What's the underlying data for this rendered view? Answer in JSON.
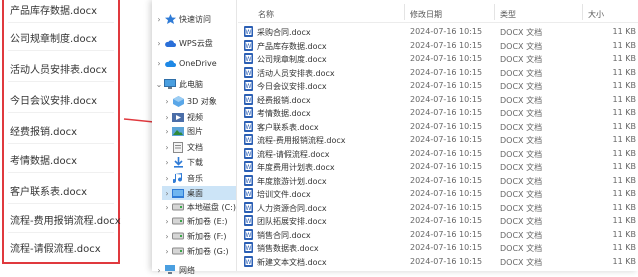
{
  "left_list": {
    "items": [
      "产品库存数据.docx",
      "公司规章制度.docx",
      "活动人员安排表.docx",
      "今日会议安排.docx",
      "经费报销.docx",
      "考情数据.docx",
      "客户联系表.docx",
      "流程-费用报销流程.docx",
      "流程-请假流程.docx"
    ]
  },
  "nav": {
    "items": [
      {
        "label": "快速访问",
        "icon": "star-icon"
      },
      {
        "label": "WPS云盘",
        "icon": "cloud-icon"
      },
      {
        "label": "OneDrive",
        "icon": "onedrive-icon"
      },
      {
        "label": "此电脑",
        "icon": "computer-icon"
      },
      {
        "label": "3D 对象",
        "icon": "cube-icon"
      },
      {
        "label": "视频",
        "icon": "video-icon"
      },
      {
        "label": "图片",
        "icon": "picture-icon"
      },
      {
        "label": "文档",
        "icon": "document-icon"
      },
      {
        "label": "下载",
        "icon": "download-icon"
      },
      {
        "label": "音乐",
        "icon": "music-icon"
      },
      {
        "label": "桌面",
        "icon": "desktop-icon"
      },
      {
        "label": "本地磁盘 (C:)",
        "icon": "drive-icon"
      },
      {
        "label": "新加卷 (E:)",
        "icon": "drive-icon"
      },
      {
        "label": "新加卷 (F:)",
        "icon": "drive-icon"
      },
      {
        "label": "新加卷 (G:)",
        "icon": "drive-icon"
      },
      {
        "label": "网络",
        "icon": "network-icon"
      }
    ]
  },
  "headers": {
    "name": "名称",
    "date": "修改日期",
    "type": "类型",
    "size": "大小"
  },
  "files": [
    {
      "name": "采购合同.docx",
      "date": "2024-07-16 10:15",
      "type": "DOCX 文档",
      "size": "11 KB"
    },
    {
      "name": "产品库存数据.docx",
      "date": "2024-07-16 10:15",
      "type": "DOCX 文档",
      "size": "11 KB"
    },
    {
      "name": "公司规章制度.docx",
      "date": "2024-07-16 10:15",
      "type": "DOCX 文档",
      "size": "11 KB"
    },
    {
      "name": "活动人员安排表.docx",
      "date": "2024-07-16 10:15",
      "type": "DOCX 文档",
      "size": "11 KB"
    },
    {
      "name": "今日会议安排.docx",
      "date": "2024-07-16 10:15",
      "type": "DOCX 文档",
      "size": "11 KB"
    },
    {
      "name": "经费报销.docx",
      "date": "2024-07-16 10:15",
      "type": "DOCX 文档",
      "size": "11 KB"
    },
    {
      "name": "考情数据.docx",
      "date": "2024-07-16 10:15",
      "type": "DOCX 文档",
      "size": "11 KB"
    },
    {
      "name": "客户联系表.docx",
      "date": "2024-07-16 10:15",
      "type": "DOCX 文档",
      "size": "11 KB"
    },
    {
      "name": "流程-费用报销流程.docx",
      "date": "2024-07-16 10:15",
      "type": "DOCX 文档",
      "size": "11 KB"
    },
    {
      "name": "流程-请假流程.docx",
      "date": "2024-07-16 10:15",
      "type": "DOCX 文档",
      "size": "11 KB"
    },
    {
      "name": "年度费用计划表.docx",
      "date": "2024-07-16 10:15",
      "type": "DOCX 文档",
      "size": "11 KB"
    },
    {
      "name": "年度旅游计划.docx",
      "date": "2024-07-16 10:15",
      "type": "DOCX 文档",
      "size": "11 KB"
    },
    {
      "name": "培训文件.docx",
      "date": "2024-07-16 10:15",
      "type": "DOCX 文档",
      "size": "11 KB"
    },
    {
      "name": "人力资源合同.docx",
      "date": "2024-07-16 10:15",
      "type": "DOCX 文档",
      "size": "11 KB"
    },
    {
      "name": "团队拓展安排.docx",
      "date": "2024-07-16 10:15",
      "type": "DOCX 文档",
      "size": "11 KB"
    },
    {
      "name": "销售合同.docx",
      "date": "2024-07-16 10:15",
      "type": "DOCX 文档",
      "size": "11 KB"
    },
    {
      "name": "销售数据表.docx",
      "date": "2024-07-16 10:15",
      "type": "DOCX 文档",
      "size": "11 KB"
    },
    {
      "name": "新建文本文档.docx",
      "date": "2024-07-16 10:15",
      "type": "DOCX 文档",
      "size": "11 KB"
    }
  ],
  "colors": {
    "highlight_border": "#e0393e",
    "arrow": "#e0393e",
    "word_icon": "#2b5fb4",
    "selected_nav": "#cce4f7"
  }
}
